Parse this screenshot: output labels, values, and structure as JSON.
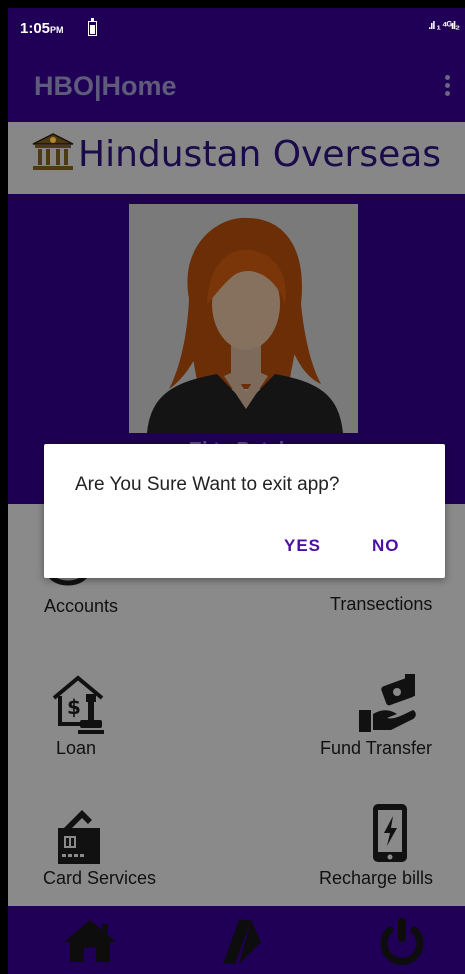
{
  "status_bar": {
    "time": "1:05",
    "ampm": "PM",
    "signal_text": ".ıl ₁ ⁴ᴳıl₂"
  },
  "app_bar": {
    "title": "HBO|Home",
    "menu_icon": "more-vert-icon"
  },
  "brand": {
    "name": "Hindustan Overseas",
    "icon": "bank-icon"
  },
  "profile": {
    "name": "Ekta Patel"
  },
  "menu": {
    "accounts": "Accounts",
    "transactions": "Transections",
    "loan": "Loan",
    "fund_transfer": "Fund Transfer",
    "card_services": "Card Services",
    "recharge_bills": "Recharge bills"
  },
  "bottom_nav": {
    "home": "home-icon",
    "forward": "forward-icon",
    "power": "power-icon"
  },
  "dialog": {
    "message": "Are You Sure Want to exit app?",
    "yes": "YES",
    "no": "NO"
  },
  "colors": {
    "primary": "#200056",
    "dialog_button": "#4b0fa6",
    "scrim_gray": "#8a8a8a"
  }
}
